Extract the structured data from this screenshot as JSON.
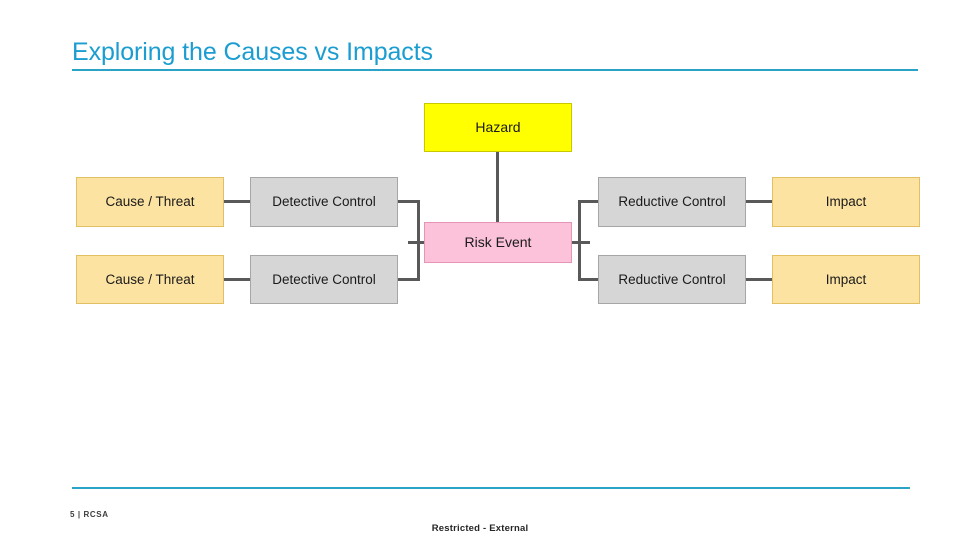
{
  "slide": {
    "title": "Exploring the Causes vs Impacts"
  },
  "diagram": {
    "type": "bowtie-risk-diagram",
    "nodes": {
      "hazard": "Hazard",
      "risk_event": "Risk Event",
      "cause_1": "Cause / Threat",
      "cause_2": "Cause / Threat",
      "detective_control_1": "Detective Control",
      "detective_control_2": "Detective Control",
      "reductive_control_1": "Reductive Control",
      "reductive_control_2": "Reductive Control",
      "impact_1": "Impact",
      "impact_2": "Impact"
    },
    "colors": {
      "cause_fill": "#fce3a2",
      "cause_border": "#e3bf63",
      "control_fill": "#d6d6d6",
      "control_border": "#a6a6a6",
      "hazard_fill": "#ffff00",
      "hazard_border": "#c8c800",
      "risk_fill": "#fbc2da",
      "risk_border": "#e794b9",
      "connector": "#595959",
      "accent": "#2aa3c7",
      "title": "#1b9dd1"
    }
  },
  "footer": {
    "page_number": "5",
    "separator": "|",
    "deck_name": "RCSA",
    "meta_line": "5  |  RCSA",
    "classification": "Restricted - External"
  }
}
